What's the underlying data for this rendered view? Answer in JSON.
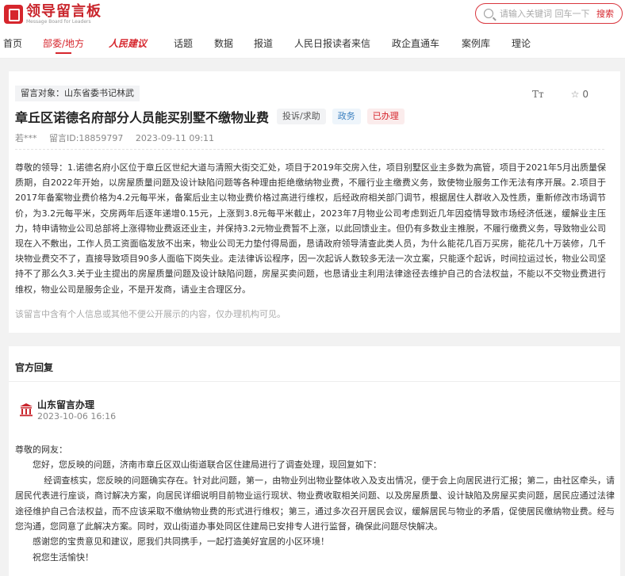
{
  "header": {
    "logo_title": "领导留言板",
    "logo_subtitle": "Message Board for Leaders",
    "search_placeholder": "请输入关键词 回车一下",
    "search_button": "搜索"
  },
  "nav": {
    "items": [
      "首页",
      "部委/地方",
      "人民建议",
      "话题",
      "数据",
      "报道",
      "人民日报读者来信",
      "政企直通车",
      "案例库",
      "理论"
    ],
    "active_index": 1
  },
  "message": {
    "target_label": "留言对象：山东省委书记林武",
    "font_toggle": "Tт",
    "star_count": "0",
    "title": "章丘区诺德名府部分人员能买别墅不缴物业费",
    "tags": {
      "type": "投诉/求助",
      "field": "政务",
      "status": "已办理"
    },
    "author": "若***",
    "message_id": "留言ID:18859797",
    "date": "2023-09-11 09:11",
    "body": "尊敬的领导：1.诺德名府小区位于章丘区世纪大道与清照大街交汇处，项目于2019年交房入住，项目别墅区业主多数为高管，项目于2021年5月出质量保质期，自2022年开始，以房屋质量问题及设计缺陷问题等各种理由拒绝缴纳物业费，不履行业主缴费义务，致使物业服务工作无法有序开展。2.项目于2017年备案物业费价格为4.2元每平米，备案后业主以物业费价格过高进行维权，后经政府相关部门调节，根据居住人群收入及性质，重新修改市场调节价，为3.2元每平米，交房两年后逐年递增0.15元，上涨到3.8元每平米截止，2023年7月物业公司考虑到近几年因疫情导致市场经济低迷，缓解业主压力，特申请物业公司总部将上涨得物业费返还业主，并保持3.2元物业费暂不上涨，以此回馈业主。但仍有多数业主推脱，不履行缴费义务，导致物业公司现在入不敷出，工作人员工资面临发放不出来，物业公司无力垫付得局面，恳请政府领导清查此类人员，为什么能花几百万买房，能花几十万装修，几千块物业费交不了，直接导致项目90多人面临下岗失业。走法律诉讼程序，因一次起诉人数较多无法一次立案，只能逐个起诉，时间拉运过长，物业公司坚持不了那么久3.关于业主提出的房屋质量问题及设计缺陷问题，房屋买卖问题，也恳请业主利用法律途径去维护自己的合法权益，不能以不交物业费进行维权，物业公司是服务企业，不是开发商，请业主合理区分。",
    "privacy_note": "该留言中含有个人信息或其他不便公开展示的内容，仅办理机构可见。"
  },
  "reply": {
    "section_title": "官方回复",
    "org_name": "山东留言办理",
    "date": "2023-10-06 16:16",
    "greeting": "尊敬的网友：",
    "p1": "您好，您反映的问题，济南市章丘区双山街道联合区住建局进行了调查处理，现回复如下：",
    "p2": "经调查核实，您反映的问题确实存在。针对此问题，第一，由物业列出物业整体收入及支出情况，便于会上向居民进行汇报；第二，由社区牵头，请居民代表进行座谈，商讨解决方案，向居民详细说明目前物业运行现状、物业费收取相关问题、以及房屋质量、设计缺陷及房屋买卖问题，居民应通过法律途径维护自己合法权益，而不应该采取不缴纳物业费的形式进行维权；第三，通过多次召开居民会议，缓解居民与物业的矛盾，促使居民缴纳物业费。经与您沟通，您同意了此解决方案。同时，双山街道办事处同区住建局已安排专人进行监督，确保此问题尽快解决。",
    "p3": "感谢您的宝贵意见和建议，愿我们共同携手，一起打造美好宜居的小区环境！",
    "p4": "祝您生活愉快！"
  }
}
